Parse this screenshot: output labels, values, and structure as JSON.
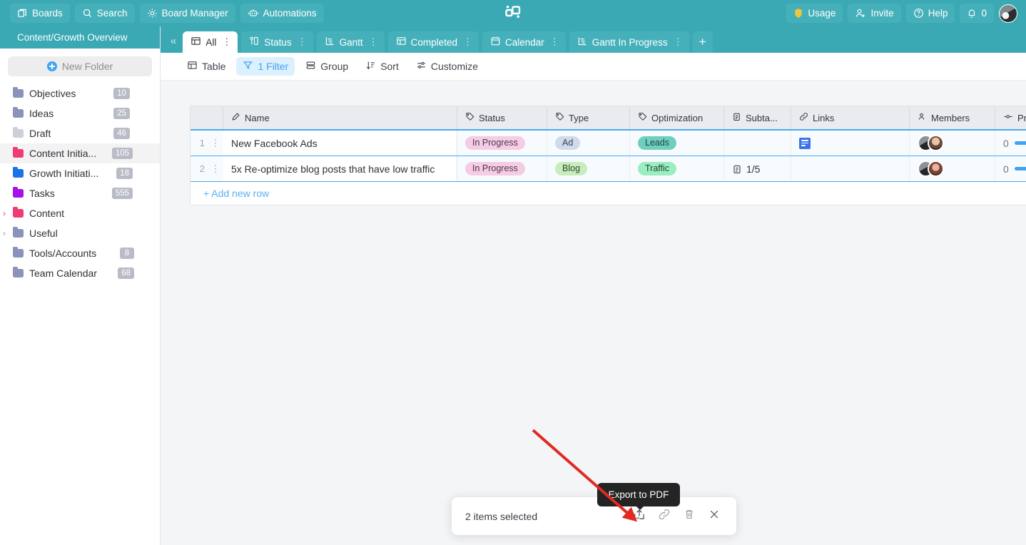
{
  "topbar": {
    "left_buttons": [
      {
        "label": "Boards",
        "icon": "boards-icon"
      },
      {
        "label": "Search",
        "icon": "search-icon"
      },
      {
        "label": "Board Manager",
        "icon": "gear-icon"
      },
      {
        "label": "Automations",
        "icon": "robot-icon"
      }
    ],
    "right_buttons": [
      {
        "label": "Usage",
        "icon": "shield-icon"
      },
      {
        "label": "Invite",
        "icon": "user-plus-icon"
      },
      {
        "label": "Help",
        "icon": "question-circle-icon"
      },
      {
        "label": "0",
        "icon": "bell-icon"
      }
    ],
    "brand_color": "#3aa9b4",
    "logo": "app-logo"
  },
  "sidebar": {
    "title": "Content/Growth Overview",
    "new_folder_label": "New Folder",
    "items": [
      {
        "label": "Objectives",
        "badge": "10",
        "color": "#8b93bb",
        "caret": "",
        "active": false
      },
      {
        "label": "Ideas",
        "badge": "25",
        "color": "#8b93bb",
        "caret": "",
        "active": false
      },
      {
        "label": "Draft",
        "badge": "46",
        "color": "#ccd0d9",
        "caret": "",
        "active": false
      },
      {
        "label": "Content Initia...",
        "badge": "105",
        "color": "#ef3d74",
        "caret": "",
        "active": true
      },
      {
        "label": "Growth Initiati...",
        "badge": "18",
        "color": "#1a73e8",
        "caret": "",
        "active": false
      },
      {
        "label": "Tasks",
        "badge": "555",
        "color": "#a511e8",
        "caret": "",
        "active": false
      },
      {
        "label": "Content",
        "badge": "",
        "color": "#ef3d74",
        "caret": "›",
        "caret_color": "#ef3d74",
        "active": false
      },
      {
        "label": "Useful",
        "badge": "",
        "color": "#8b93bb",
        "caret": "›",
        "caret_color": "#8b93bb",
        "active": false
      },
      {
        "label": "Tools/Accounts",
        "badge": "8",
        "color": "#8b93bb",
        "caret": "",
        "active": false
      },
      {
        "label": "Team Calendar",
        "badge": "68",
        "color": "#8b93bb",
        "caret": "",
        "active": false
      }
    ]
  },
  "tabstrip": {
    "collapse_label": "«",
    "tabs": [
      {
        "label": "All",
        "icon": "table-icon",
        "active": true
      },
      {
        "label": "Status",
        "icon": "kanban-icon",
        "active": false
      },
      {
        "label": "Gantt",
        "icon": "gantt-icon",
        "active": false
      },
      {
        "label": "Completed",
        "icon": "table-icon",
        "active": false
      },
      {
        "label": "Calendar",
        "icon": "calendar-icon",
        "active": false
      },
      {
        "label": "Gantt In Progress",
        "icon": "gantt-icon",
        "active": false
      }
    ],
    "add_label": "+",
    "menu_dots": "⋮"
  },
  "toolbar": {
    "items": [
      {
        "label": "Table",
        "icon": "table-icon",
        "active": false
      },
      {
        "label": "1 Filter",
        "icon": "filter-icon",
        "active": true
      },
      {
        "label": "Group",
        "icon": "group-icon",
        "active": false
      },
      {
        "label": "Sort",
        "icon": "sort-icon",
        "active": false
      },
      {
        "label": "Customize",
        "icon": "sliders-icon",
        "active": false
      }
    ],
    "accent_color": "#3fa3f4"
  },
  "grid": {
    "columns": [
      {
        "label": "Name",
        "icon": "pencil-icon"
      },
      {
        "label": "Status",
        "icon": "tag-icon"
      },
      {
        "label": "Type",
        "icon": "tag-icon"
      },
      {
        "label": "Optimization",
        "icon": "tag-icon"
      },
      {
        "label": "Subta...",
        "icon": "clipboard-icon"
      },
      {
        "label": "Links",
        "icon": "link-icon"
      },
      {
        "label": "Members",
        "icon": "people-icon"
      },
      {
        "label": "Progr",
        "icon": "progress-icon"
      }
    ],
    "rows": [
      {
        "index": "1",
        "name": "New Facebook Ads",
        "status": "In Progress",
        "type": "Ad",
        "type_style": "ad",
        "optimization": "Leads",
        "opt_style": "leads",
        "subtasks": "",
        "links_icon": "google-doc-icon",
        "progress_value": "0",
        "selected": true
      },
      {
        "index": "2",
        "name": "5x Re-optimize blog posts that have low traffic",
        "status": "In Progress",
        "type": "Blog",
        "type_style": "blog",
        "optimization": "Traffic",
        "opt_style": "traffic",
        "subtasks": "1/5",
        "links_icon": "",
        "progress_value": "0",
        "selected": true
      }
    ],
    "add_row_label": "+ Add new row",
    "row_menu_dots": "⋮"
  },
  "selection_bar": {
    "text": "2 items selected",
    "actions": [
      {
        "name": "export-pdf-button",
        "icon": "export-pdf-icon"
      },
      {
        "name": "copy-link-button",
        "icon": "link-icon"
      },
      {
        "name": "delete-button",
        "icon": "trash-icon"
      },
      {
        "name": "close-button",
        "icon": "close-icon"
      }
    ]
  },
  "tooltip": {
    "text": "Export to PDF"
  },
  "annotation": {
    "arrow_color": "#e02b20"
  }
}
